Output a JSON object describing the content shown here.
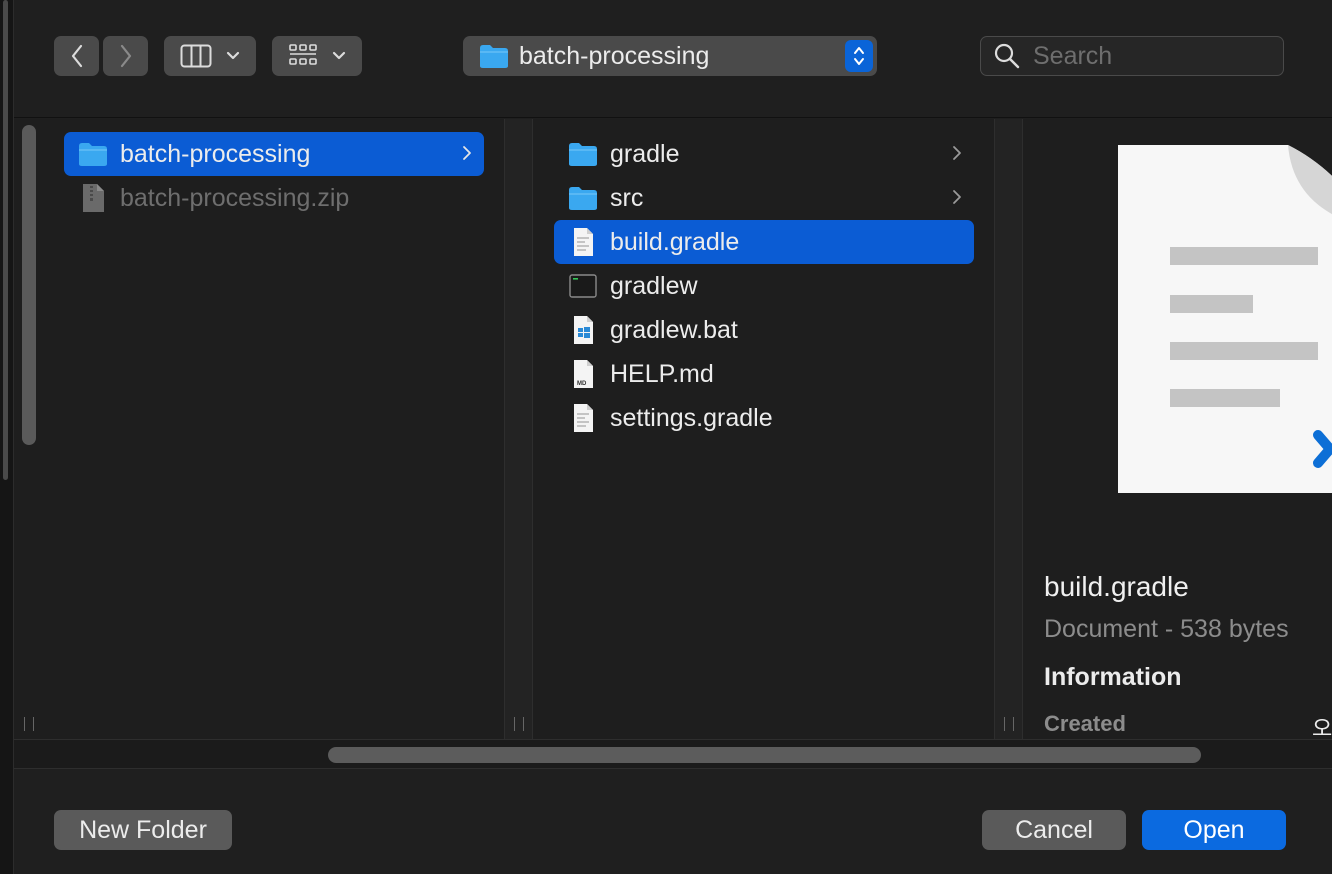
{
  "toolbar": {
    "path_popup_label": "batch-processing",
    "search_placeholder": "Search"
  },
  "columns": {
    "col1": [
      {
        "name": "batch-processing",
        "type": "folder",
        "selected": true,
        "dimmed": false,
        "has_children": true
      },
      {
        "name": "batch-processing.zip",
        "type": "zip",
        "selected": false,
        "dimmed": true,
        "has_children": false
      }
    ],
    "col2": [
      {
        "name": "gradle",
        "type": "folder",
        "selected": false,
        "has_children": true
      },
      {
        "name": "src",
        "type": "folder",
        "selected": false,
        "has_children": true
      },
      {
        "name": "build.gradle",
        "type": "document",
        "selected": true,
        "has_children": false
      },
      {
        "name": "gradlew",
        "type": "executable",
        "selected": false,
        "has_children": false
      },
      {
        "name": "gradlew.bat",
        "type": "bat",
        "selected": false,
        "has_children": false
      },
      {
        "name": "HELP.md",
        "type": "markdown",
        "selected": false,
        "has_children": false
      },
      {
        "name": "settings.gradle",
        "type": "document",
        "selected": false,
        "has_children": false
      }
    ]
  },
  "preview": {
    "name": "build.gradle",
    "kind": "Document - 538 bytes",
    "information_heading": "Information",
    "created_label": "Created",
    "created_value": "오"
  },
  "footer": {
    "new_folder_label": "New Folder",
    "cancel_label": "Cancel",
    "open_label": "Open"
  },
  "colors": {
    "selection": "#0b5cd4",
    "accent": "#0b6ae0",
    "folder": "#3aa8f0"
  }
}
